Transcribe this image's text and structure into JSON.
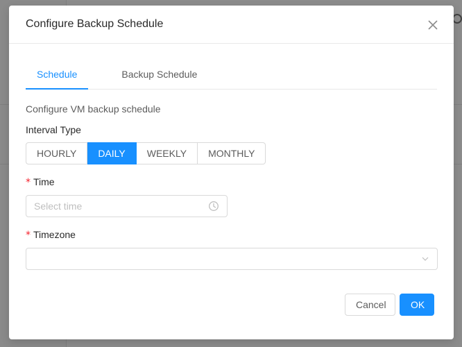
{
  "modal": {
    "title": "Configure Backup Schedule",
    "tabs": [
      {
        "label": "Schedule",
        "active": true
      },
      {
        "label": "Backup Schedule",
        "active": false
      }
    ],
    "description": "Configure VM backup schedule",
    "interval_type": {
      "label": "Interval Type",
      "options": [
        "HOURLY",
        "DAILY",
        "WEEKLY",
        "MONTHLY"
      ],
      "selected": "DAILY"
    },
    "time": {
      "label": "Time",
      "required": true,
      "value": "",
      "placeholder": "Select time"
    },
    "timezone": {
      "label": "Timezone",
      "required": true,
      "value": ""
    },
    "buttons": {
      "cancel": "Cancel",
      "ok": "OK"
    }
  },
  "colors": {
    "primary": "#1890ff",
    "required": "#f5222d",
    "mask": "rgba(0,0,0,0.45)"
  }
}
